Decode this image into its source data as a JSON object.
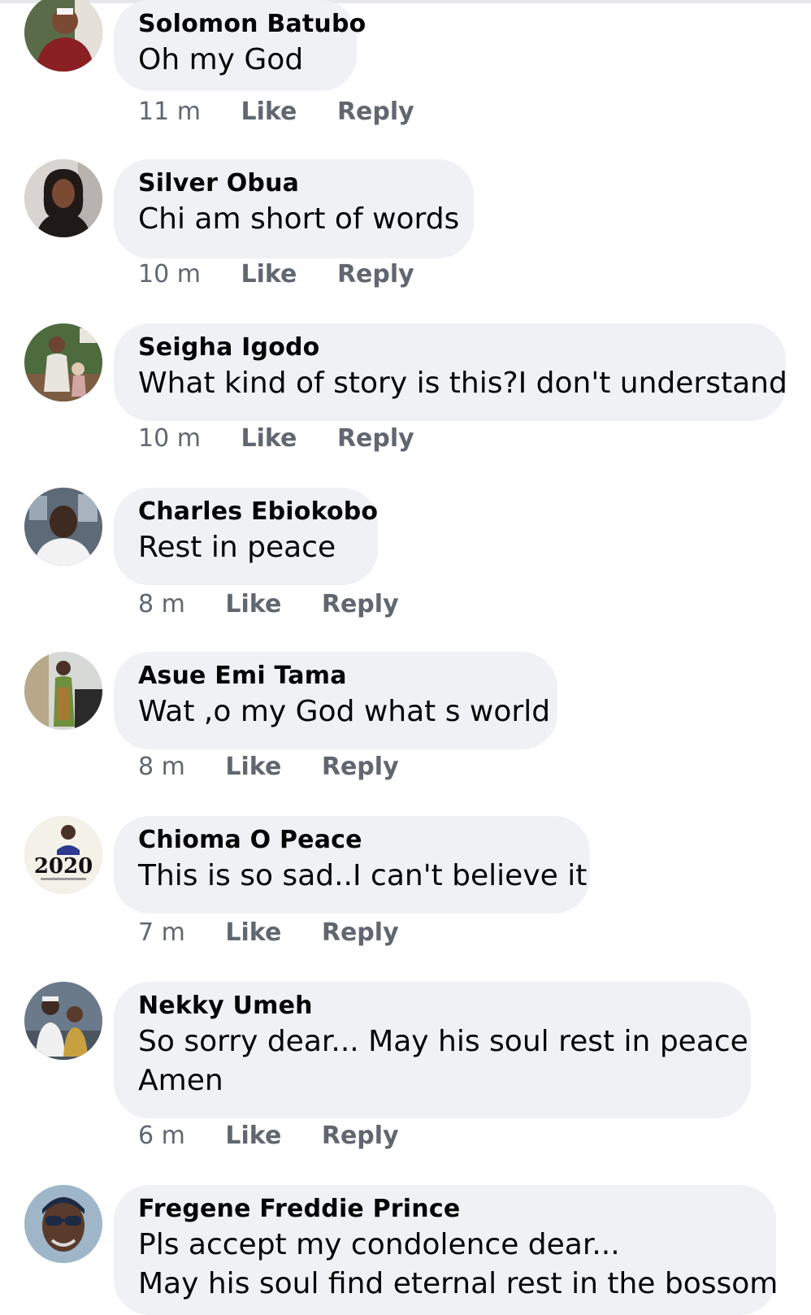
{
  "comments": [
    {
      "author": "Solomon Batubo",
      "text": "Oh my God",
      "time": "11 m",
      "like_label": "Like",
      "reply_label": "Reply",
      "avatar_colors": [
        "#5a6b4a",
        "#8a1f24",
        "#7b4a32"
      ]
    },
    {
      "author": "Silver Obua",
      "text": "Chi am short of words",
      "time": "10 m",
      "like_label": "Like",
      "reply_label": "Reply",
      "avatar_colors": [
        "#d9d4cf",
        "#1f1a18",
        "#7a4a33"
      ]
    },
    {
      "author": "Seigha Igodo",
      "text": "What kind of story is this?I don't understand",
      "time": "10 m",
      "like_label": "Like",
      "reply_label": "Reply",
      "avatar_colors": [
        "#4d6b3c",
        "#e8e4de",
        "#6d4331"
      ]
    },
    {
      "author": "Charles Ebiokobo",
      "text": "Rest in peace",
      "time": "8 m",
      "like_label": "Like",
      "reply_label": "Reply",
      "avatar_colors": [
        "#5d6a78",
        "#f2f2f2",
        "#3e2a21"
      ]
    },
    {
      "author": "Asue Emi Tama",
      "text": "Wat ,o my God what s world",
      "time": "8 m",
      "like_label": "Like",
      "reply_label": "Reply",
      "avatar_colors": [
        "#d6d9d6",
        "#6f8f3c",
        "#4a3128"
      ]
    },
    {
      "author": "Chioma O Peace",
      "text": "This is so sad..I can't believe it",
      "time": "7 m",
      "like_label": "Like",
      "reply_label": "Reply",
      "avatar_colors": [
        "#f4f1e8",
        "#2b3a8f",
        "#111111"
      ]
    },
    {
      "author": "Nekky Umeh",
      "text_lines": [
        "So sorry dear... May his soul rest in peace",
        "Amen"
      ],
      "time": "6 m",
      "like_label": "Like",
      "reply_label": "Reply",
      "avatar_colors": [
        "#6b7a8a",
        "#f0f0f0",
        "#3f2b22"
      ]
    },
    {
      "author": "Fregene Freddie Prince",
      "text_lines": [
        "Pls accept my condolence dear...",
        "May his soul find eternal rest in the bossom"
      ],
      "avatar_colors": [
        "#9fb6c8",
        "#1d2a44",
        "#5a3a2a"
      ]
    }
  ],
  "avatar_badge_text": "2020"
}
